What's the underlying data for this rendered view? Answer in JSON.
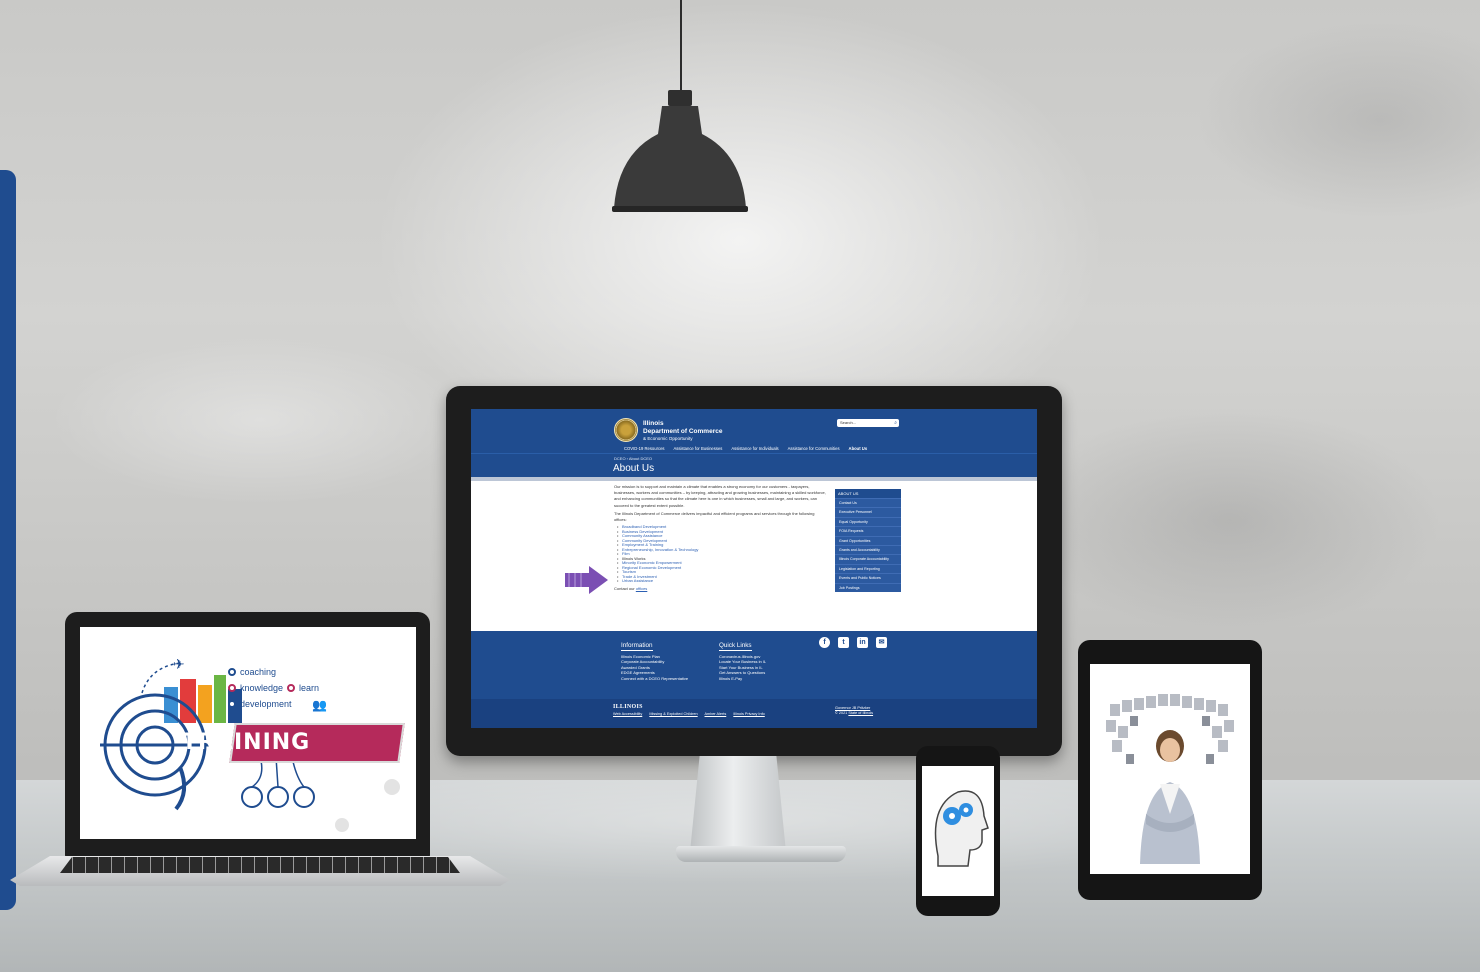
{
  "site": {
    "brand": {
      "line1": "Illinois",
      "line2": "Department of Commerce",
      "line3": "& Economic Opportunity"
    },
    "search_placeholder": "Search...",
    "nav": [
      "COVID-19 Resources",
      "Assistance for Businesses",
      "Assistance for Individuals",
      "Assistance for Communities",
      "About Us"
    ],
    "breadcrumb": "DCEO  ›  About DCEO",
    "page_title": "About Us",
    "intro": "Our mission is to support and maintain a climate that enables a strong economy for our customers - taxpayers, businesses, workers and communities – by keeping, attracting and growing businesses, maintaining a skilled workforce, and enhancing communities so that the climate here is one in which businesses, small and large, and workers, can succeed to the greatest extent possible.",
    "offices_intro": "The Illinois Department of Commerce delivers impactful and efficient programs and services through the following offices:",
    "offices": [
      "Broadband Development",
      "Business Development",
      "Community Assistance",
      "Community Development",
      "Employment & Training",
      "Entrepreneurship, Innovation & Technology",
      "Film",
      "Illinois Works",
      "Minority Economic Empowerment",
      "Regional Economic Development",
      "Tourism",
      "Trade & Investment",
      "Urban Assistance"
    ],
    "contact_prefix": "Contact our",
    "contact_link": "offices",
    "side_nav": {
      "heading": "ABOUT US",
      "items": [
        "Contact Us",
        "Executive Personnel",
        "Equal Opportunity",
        "FOIA Requests",
        "Grant Opportunities",
        "Grants and Accountability",
        "Illinois Corporate Accountability",
        "Legislation and Reporting",
        "Events and Public Notices",
        "Job Postings"
      ]
    },
    "footer": {
      "information_heading": "Information",
      "information_links": [
        "Illinois Economic Plan",
        "Corporate Accountability",
        "Awarded Grants",
        "EDGE Agreements",
        "Connect with a DCEO Representative"
      ],
      "quick_heading": "Quick Links",
      "quick_links": [
        "Coronavirus.Illinois.gov",
        "Locate Your Business in IL",
        "Start Your Business in IL",
        "Get Answers to Questions",
        "Illinois E-Pay"
      ],
      "social_icons": [
        "facebook-icon",
        "twitter-icon",
        "linkedin-icon",
        "email-icon"
      ],
      "illinois_logo": "ILLINOIS",
      "bottom_links": [
        "Web Accessibility",
        "Missing & Exploited Children",
        "Amber Alerts",
        "Illinois Privacy Info"
      ],
      "governor": "Governor JB Pritzker",
      "copyright_prefix": "© 2021",
      "copyright_link": "State of Illinois"
    }
  },
  "laptop": {
    "banner_word": "TRAINING",
    "bullets": [
      "coaching",
      "knowledge",
      "learn",
      "development"
    ]
  },
  "colors": {
    "site_blue": "#1f4c8f",
    "training_pink": "#b52a5b",
    "arrow_purple": "#7b4fb3"
  }
}
